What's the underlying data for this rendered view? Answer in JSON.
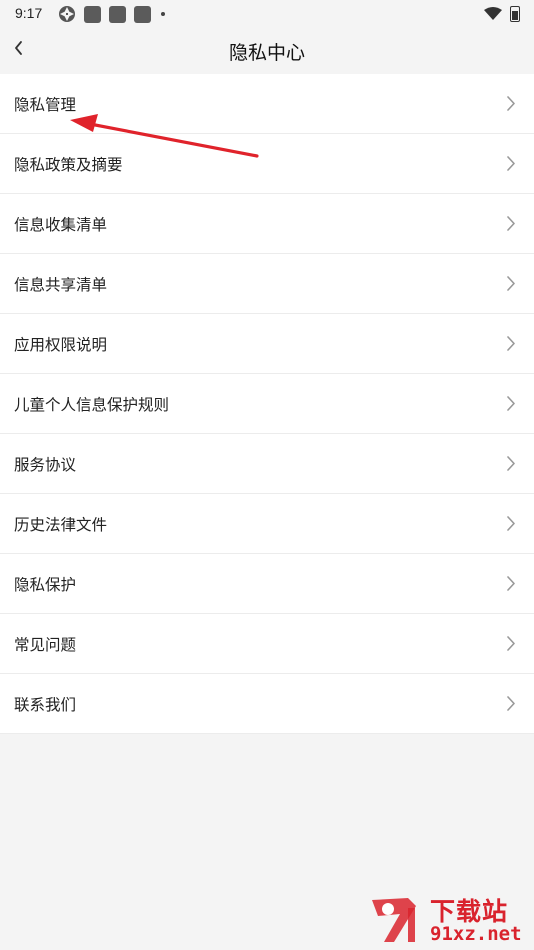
{
  "status_bar": {
    "time": "9:17"
  },
  "header": {
    "title": "隐私中心"
  },
  "menu": {
    "items": [
      {
        "label": "隐私管理"
      },
      {
        "label": "隐私政策及摘要"
      },
      {
        "label": "信息收集清单"
      },
      {
        "label": "信息共享清单"
      },
      {
        "label": "应用权限说明"
      },
      {
        "label": "儿童个人信息保护规则"
      },
      {
        "label": "服务协议"
      },
      {
        "label": "历史法律文件"
      },
      {
        "label": "隐私保护"
      },
      {
        "label": "常见问题"
      },
      {
        "label": "联系我们"
      }
    ]
  },
  "icons": {
    "back": "chevron-left-icon",
    "row": "chevron-right-icon",
    "annotation": "red-arrow-icon",
    "watermark_logo": "91-logo-icon"
  },
  "colors": {
    "background": "#f4f4f4",
    "list_background": "#ffffff",
    "annotation": "#e0232b",
    "watermark": "#d9232d"
  },
  "watermark": {
    "title": "下载站",
    "site": "91xz.net"
  }
}
